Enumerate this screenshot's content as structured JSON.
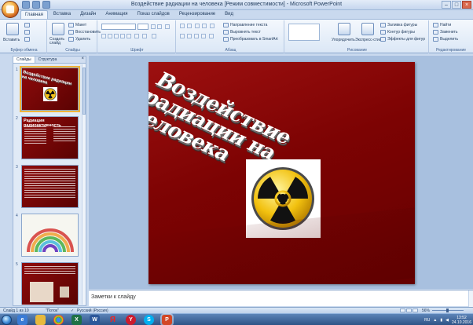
{
  "window": {
    "title": "Воздействие радиации на человека [Режим совместимости] - Microsoft PowerPoint",
    "controls": [
      "–",
      "□",
      "×"
    ]
  },
  "ribbon": {
    "tabs": [
      "Главная",
      "Вставка",
      "Дизайн",
      "Анимация",
      "Показ слайдов",
      "Рецензирование",
      "Вид"
    ],
    "active_tab": "Главная",
    "clipboard": {
      "paste": "Вставить",
      "cut": "Вырезать",
      "copy": "Копировать",
      "format": "Формат по образцу",
      "label": "Буфер обмена"
    },
    "slides": {
      "new_slide": "Создать слайд",
      "layout": "Макет",
      "reset": "Восстановить",
      "delete": "Удалить",
      "label": "Слайды"
    },
    "font": {
      "label": "Шрифт"
    },
    "paragraph": {
      "label": "Абзац",
      "text_direction": "Направление текста",
      "align_text": "Выровнять текст",
      "smartart": "Преобразовать в SmartArt"
    },
    "drawing": {
      "label": "Рисование",
      "arrange": "Упорядочить",
      "quick_styles": "Экспресс-стили",
      "fill": "Заливка фигуры",
      "outline": "Контур фигуры",
      "effects": "Эффекты для фигур"
    },
    "editing": {
      "label": "Редактирование",
      "find": "Найти",
      "replace": "Заменить",
      "select": "Выделить"
    }
  },
  "panel": {
    "tabs": [
      "Слайды",
      "Структура"
    ],
    "close": "×",
    "slides": [
      {
        "num": "1",
        "title": "Воздействие радиации на человека",
        "kind": "title"
      },
      {
        "num": "2",
        "title": "Радиация радиоактивность",
        "kind": "text"
      },
      {
        "num": "3",
        "title": "",
        "kind": "text"
      },
      {
        "num": "4",
        "title": "",
        "kind": "diagram"
      },
      {
        "num": "5",
        "title": "",
        "kind": "text-image"
      }
    ]
  },
  "slide": {
    "title": "Воздействие радиации на человека",
    "image": "radiation-icon"
  },
  "notes": {
    "placeholder": "Заметки к слайду"
  },
  "status": {
    "slide_info": "Слайд 1 из 10",
    "theme": "\"Поток\"",
    "language": "Русский (Россия)",
    "zoom": "56%"
  },
  "taskbar": {
    "icons": [
      "ie-icon",
      "folder-icon",
      "chrome-icon",
      "excel-icon",
      "word-icon",
      "yandex-icon",
      "opera-icon",
      "skype-icon",
      "powerpoint-icon"
    ],
    "lang": "RU",
    "time": "13:52",
    "date": "24.10.2016"
  },
  "colors": {
    "slide_bg": "#7d0303",
    "ribbon_bg": "#dbe7f6",
    "accent": "#f0b43a"
  }
}
